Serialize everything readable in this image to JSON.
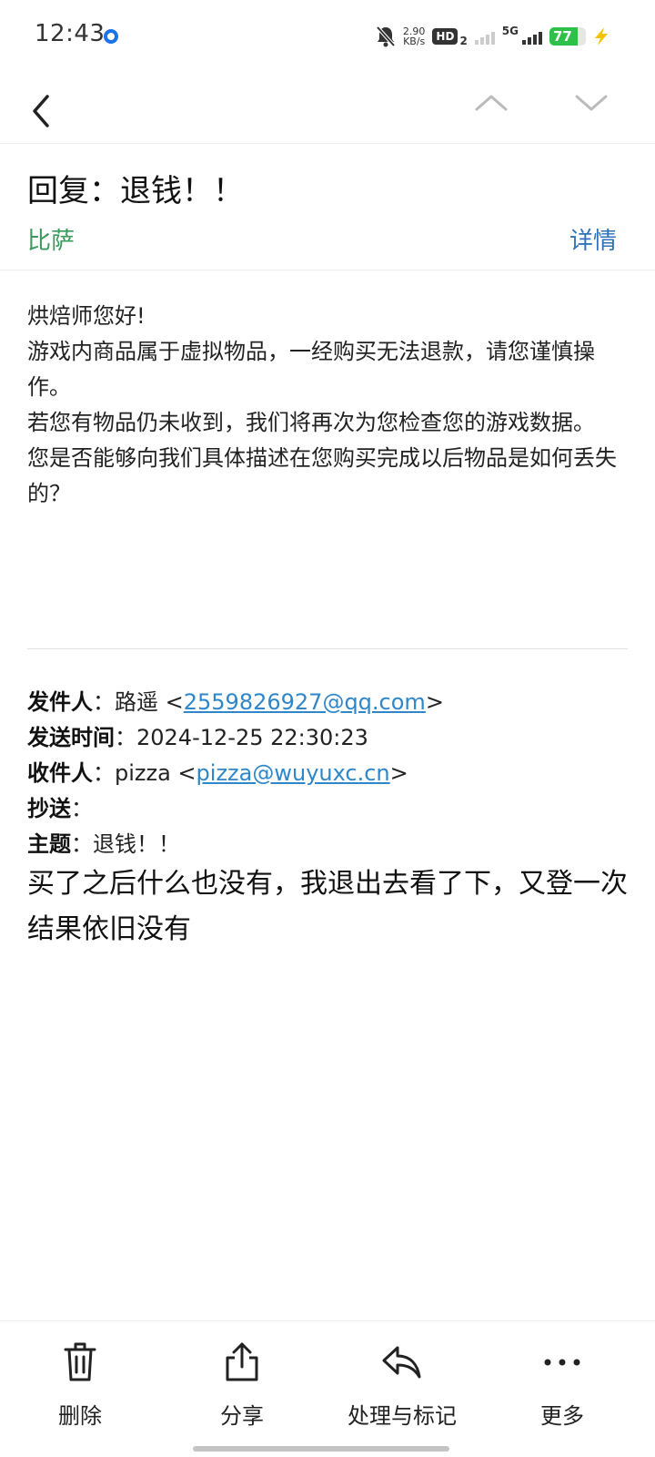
{
  "status_bar": {
    "time": "12:43",
    "net_speed_value": "2.90",
    "net_speed_unit": "KB/s",
    "hd_label": "HD",
    "hd_sub": "2",
    "network_type": "5G",
    "battery_level": 77,
    "battery_text": "77",
    "accent_color": "#1a73e8",
    "battery_color": "#2fc147"
  },
  "nav": {
    "back_icon": "chevron-left-icon",
    "up_icon": "chevron-up-icon",
    "down_icon": "chevron-down-icon"
  },
  "email": {
    "subject": "回复：退钱！！",
    "sender": "比萨",
    "details": "详情",
    "body": [
      "烘焙师您好!",
      "游戏内商品属于虚拟物品，一经购买无法退款，请您谨慎操作。",
      "若您有物品仍未收到，我们将再次为您检查您的游戏数据。",
      "您是否能够向我们具体描述在您购买完成以后物品是如何丢失的？"
    ]
  },
  "quoted": {
    "from_label": "发件人",
    "from_name": "路遥 <",
    "from_email": "2559826927@qq.com",
    "from_close": ">",
    "time_label": "发送时间",
    "time_value": "2024-12-25 22:30:23",
    "to_label": "收件人",
    "to_name": "pizza <",
    "to_email": "pizza@wuyuxc.cn",
    "to_close": ">",
    "cc_label": "抄送",
    "subject_label": "主题",
    "subject_value": "退钱！！",
    "colon": "：",
    "message": "买了之后什么也没有，我退出去看了下，又登一次结果依旧没有"
  },
  "toolbar": {
    "delete": "删除",
    "share": "分享",
    "handle": "处理与标记",
    "more": "更多"
  },
  "colors": {
    "sender_green": "#3a9a5b",
    "link_blue": "#2f86c9",
    "details_blue": "#2f72b8"
  }
}
